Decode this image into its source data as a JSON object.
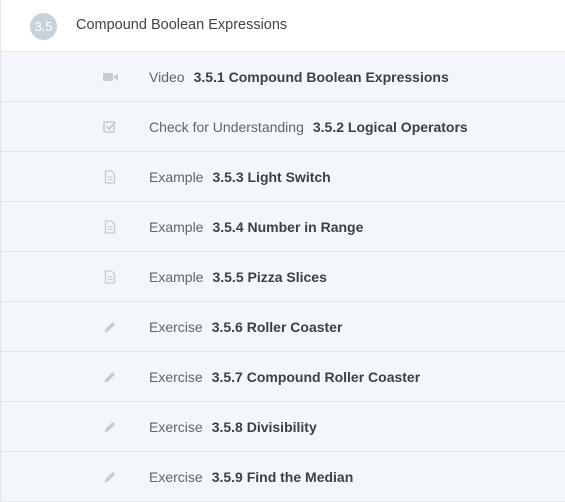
{
  "section": {
    "number": "3.5",
    "title": "Compound Boolean Expressions"
  },
  "items": [
    {
      "icon": "video-icon",
      "type": "Video",
      "name": "3.5.1 Compound Boolean Expressions"
    },
    {
      "icon": "checkbox-icon",
      "type": "Check for Understanding",
      "name": "3.5.2 Logical Operators"
    },
    {
      "icon": "document-icon",
      "type": "Example",
      "name": "3.5.3 Light Switch"
    },
    {
      "icon": "document-icon",
      "type": "Example",
      "name": "3.5.4 Number in Range"
    },
    {
      "icon": "document-icon",
      "type": "Example",
      "name": "3.5.5 Pizza Slices"
    },
    {
      "icon": "pencil-icon",
      "type": "Exercise",
      "name": "3.5.6 Roller Coaster"
    },
    {
      "icon": "pencil-icon",
      "type": "Exercise",
      "name": "3.5.7 Compound Roller Coaster"
    },
    {
      "icon": "pencil-icon",
      "type": "Exercise",
      "name": "3.5.8 Divisibility"
    },
    {
      "icon": "pencil-icon",
      "type": "Exercise",
      "name": "3.5.9 Find the Median"
    }
  ],
  "colors": {
    "icon": "#c3cbd3",
    "row_background": "#f3f6fa",
    "badge": "#c7d1da"
  }
}
